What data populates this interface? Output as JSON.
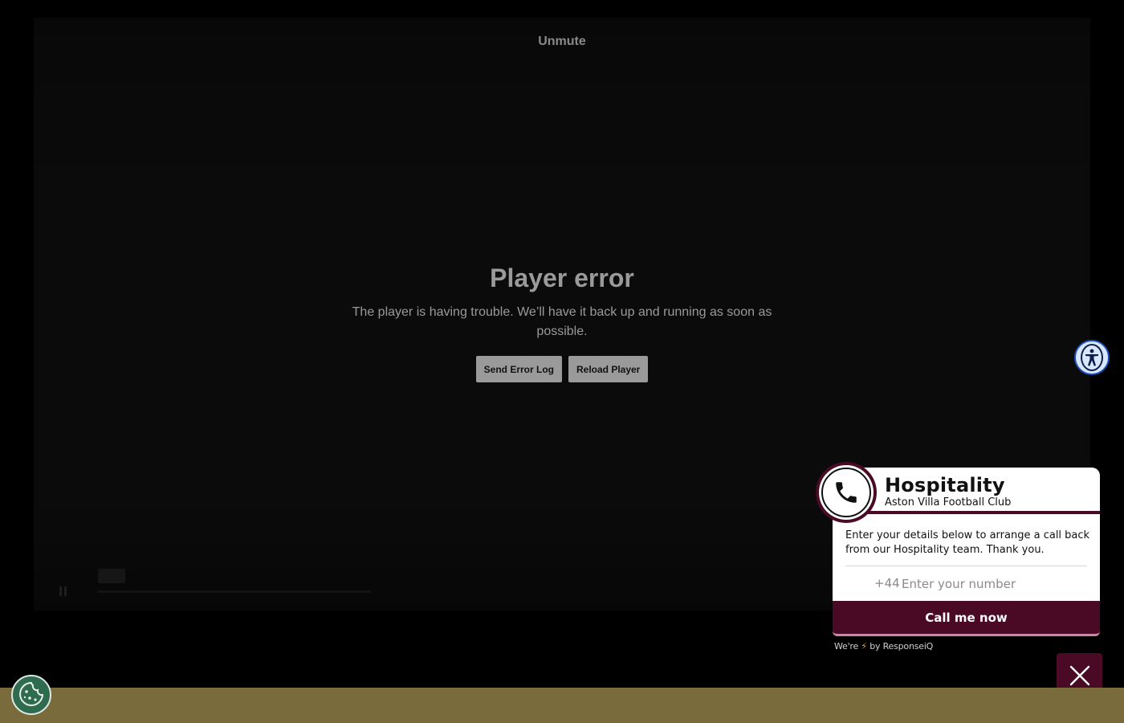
{
  "player": {
    "unmute_label": "Unmute",
    "error_title": "Player error",
    "error_message": "The player is having trouble. We’ll have it back up and running as soon as possible.",
    "send_error_log_label": "Send Error Log",
    "reload_player_label": "Reload Player"
  },
  "callback_widget": {
    "title": "Hospitality",
    "subtitle": "Aston Villa Football Club",
    "description": "Enter your details below to arrange a call back from our Hospitality team. Thank you.",
    "country_code": "+44",
    "phone_placeholder": "Enter your number",
    "cta_label": "Call me now",
    "powered_prefix": "We're",
    "powered_suffix": "by ResponseiQ"
  },
  "icons": {
    "accessibility": "accessibility-icon",
    "phone": "phone-icon",
    "close": "close-icon",
    "cookie": "cookie-icon",
    "bolt": "lightning-bolt-icon"
  },
  "colors": {
    "claret": "#4a0a25",
    "footer_gold": "#7a6b3c",
    "cookie_green": "#2e6b4f",
    "accessibility_blue": "#1d4fb8"
  }
}
